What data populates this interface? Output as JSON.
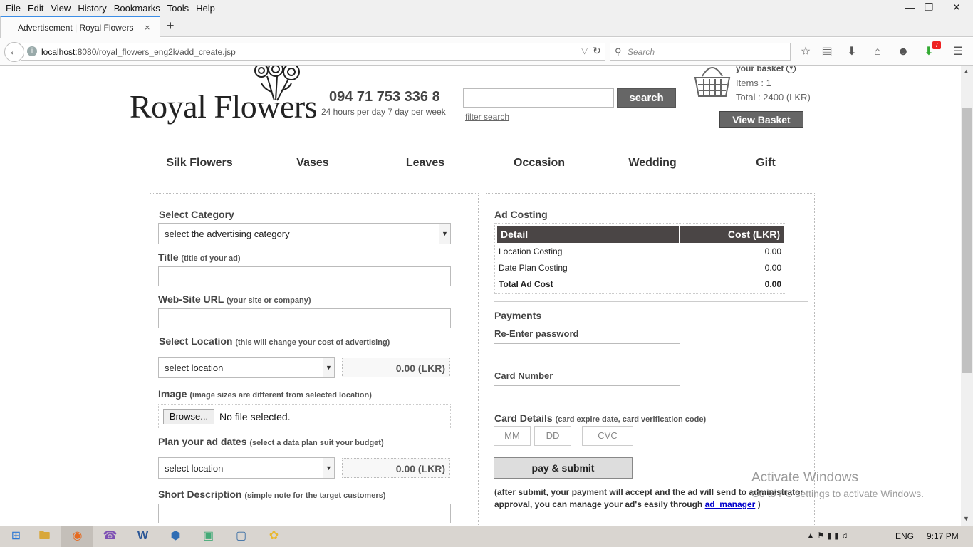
{
  "menubar": {
    "items": [
      "File",
      "Edit",
      "View",
      "History",
      "Bookmarks",
      "Tools",
      "Help"
    ]
  },
  "tab": {
    "title": "Advertisement | Royal Flowers",
    "close": "×",
    "new": "+"
  },
  "address": {
    "host": "localhost",
    "path": ":8080/royal_flowers_eng2k/add_create.jsp"
  },
  "search": {
    "placeholder": "Search"
  },
  "toolbar": {
    "badge": "7"
  },
  "header": {
    "logo": "Royal Flowers",
    "phone": "094 71 753 336 8",
    "hours": "24 hours per day 7 day per week",
    "search_button": "search",
    "filter_search": "filter search",
    "basket_label": "your basket",
    "items": "Items : 1",
    "total": "Total : 2400 (LKR)",
    "view_basket": "View Basket"
  },
  "nav": [
    "Silk Flowers",
    "Vases",
    "Leaves",
    "Occasion",
    "Wedding",
    "Gift"
  ],
  "form": {
    "category_label": "Select Category",
    "category_value": "select the advertising category",
    "title_label": "Title",
    "title_hint": "(title of your ad)",
    "url_label": "Web-Site URL",
    "url_hint": "(your site or company)",
    "location_label": "Select Location",
    "location_hint": "(this will change your cost of advertising)",
    "location_value": "select location",
    "location_cost": "0.00 (LKR)",
    "image_label": "Image",
    "image_hint": "(image sizes are different from selected location)",
    "browse": "Browse...",
    "no_file": "No file selected.",
    "plan_label": "Plan your ad dates",
    "plan_hint": "(select a data plan suit your budget)",
    "plan_value": "select location",
    "plan_cost": "0.00 (LKR)",
    "desc_label": "Short Description",
    "desc_hint": "(simple note for the target customers)"
  },
  "costing": {
    "title": "Ad Costing",
    "col_detail": "Detail",
    "col_cost": "Cost (LKR)",
    "rows": [
      {
        "label": "Location Costing",
        "value": "0.00"
      },
      {
        "label": "Date Plan Costing",
        "value": "0.00"
      },
      {
        "label": "Total Ad Cost",
        "value": "0.00"
      }
    ]
  },
  "payments": {
    "title": "Payments",
    "password_label": "Re-Enter password",
    "card_label": "Card Number",
    "details_label": "Card Details",
    "details_hint": "(card expire date, card verification code)",
    "mm": "MM",
    "dd": "DD",
    "cvc": "CVC",
    "pay_button": "pay & submit",
    "note_text": "(after submit, your payment will accept and the ad will send to administrator approval, you can manage your ad's easily through",
    "note_link": "ad_manager",
    "note_end": ")"
  },
  "watermark": {
    "line1": "Activate Windows",
    "line2": "Go to PC settings to activate Windows."
  },
  "taskbar": {
    "lang": "ENG",
    "time": "9:17 PM"
  }
}
